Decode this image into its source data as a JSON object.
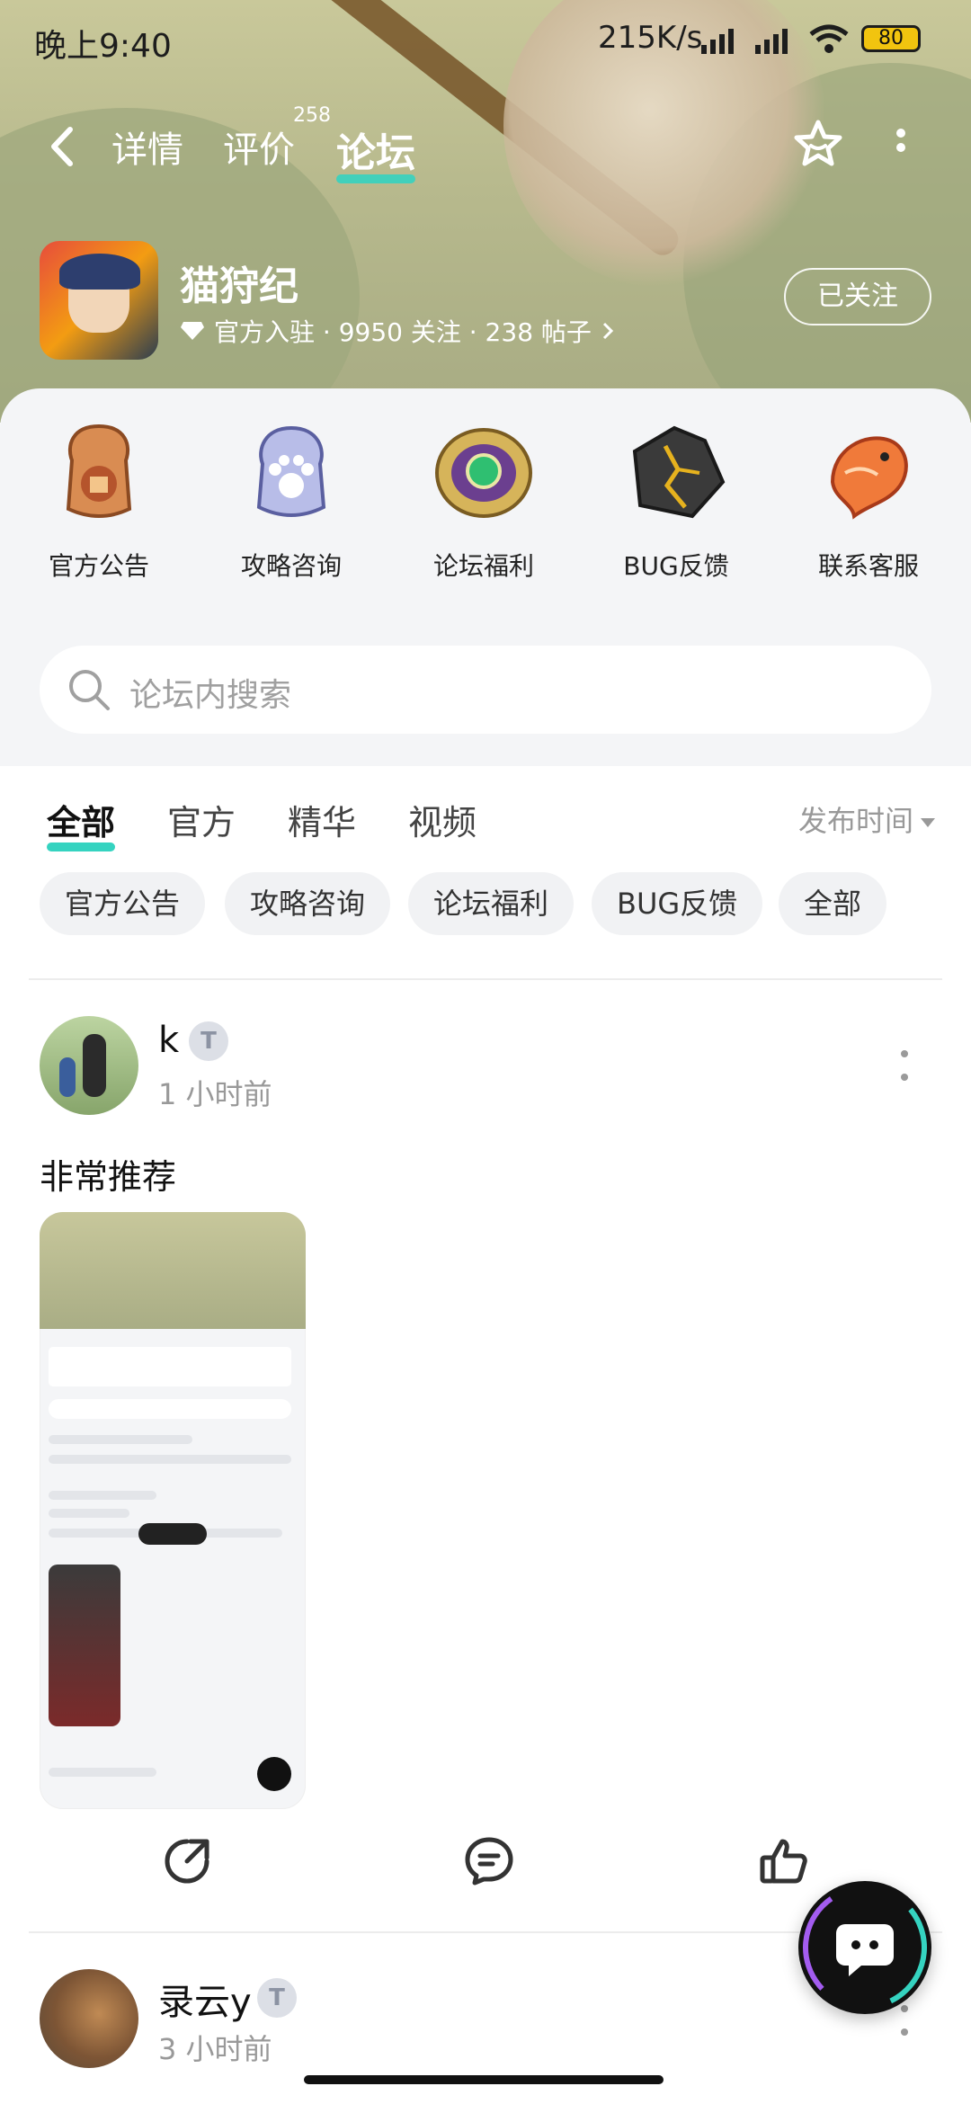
{
  "status_bar": {
    "time": "晚上9:40",
    "network_speed": "215K/s",
    "battery": "80"
  },
  "nav": {
    "tabs": [
      {
        "label": "详情",
        "badge": ""
      },
      {
        "label": "评价",
        "badge": "258"
      },
      {
        "label": "论坛",
        "badge": ""
      }
    ],
    "active_tab": "论坛"
  },
  "game": {
    "name": "猫狩纪",
    "meta": "官方入驻 · 9950 关注 · 238 帖子",
    "follow_label": "已关注"
  },
  "categories": [
    {
      "label": "官方公告",
      "icon": "announcement-badge-icon"
    },
    {
      "label": "攻略咨询",
      "icon": "paw-badge-icon"
    },
    {
      "label": "论坛福利",
      "icon": "gem-badge-icon"
    },
    {
      "label": "BUG反馈",
      "icon": "cracked-stone-icon"
    },
    {
      "label": "联系客服",
      "icon": "koi-fish-icon"
    }
  ],
  "search": {
    "placeholder": "论坛内搜索"
  },
  "filter_tabs": [
    "全部",
    "官方",
    "精华",
    "视频"
  ],
  "active_filter": "全部",
  "sort_label": "发布时间",
  "chips": [
    "官方公告",
    "攻略咨询",
    "论坛福利",
    "BUG反馈",
    "全部"
  ],
  "posts": [
    {
      "user": "k",
      "level": "T",
      "time": "1 小时前",
      "text": "非常推荐"
    },
    {
      "user": "录云y",
      "level": "T",
      "time": "3 小时前",
      "text": ""
    }
  ],
  "colors": {
    "accent": "#35d3c0",
    "chip_bg": "#f1f2f4",
    "panel_bg": "#f4f5f7"
  }
}
